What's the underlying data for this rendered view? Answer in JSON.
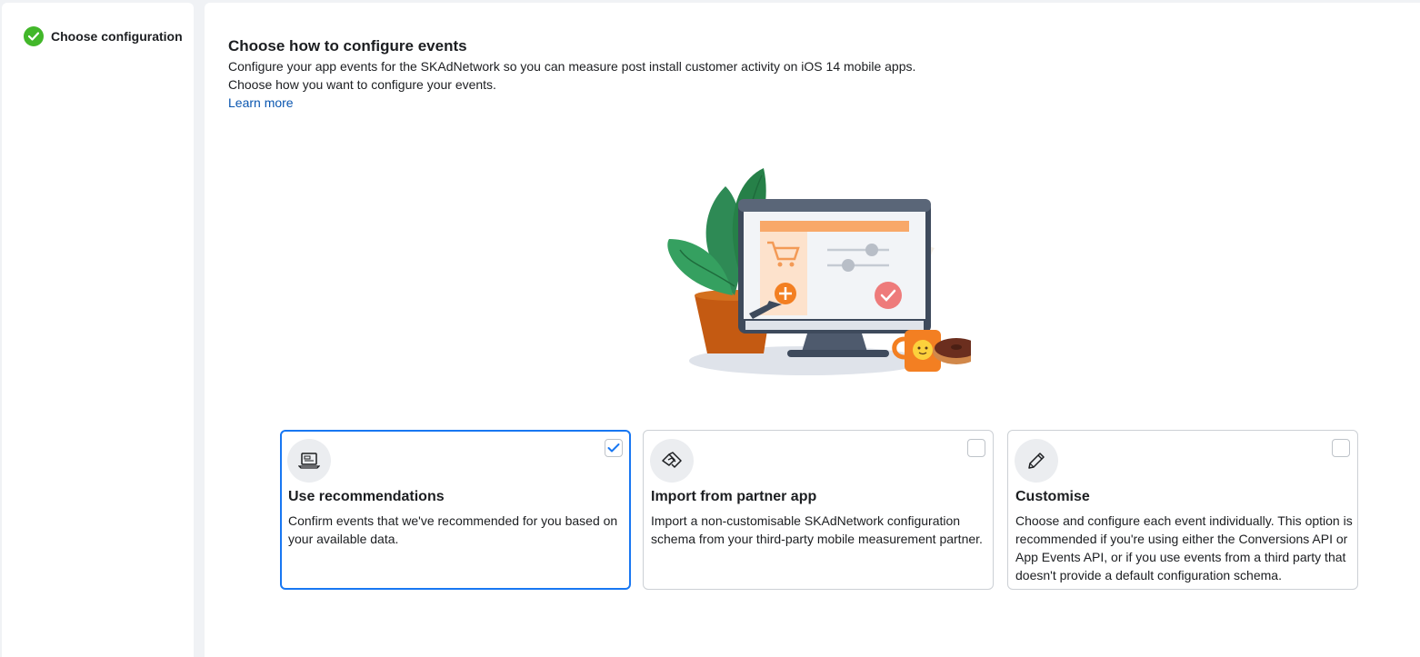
{
  "sidebar": {
    "steps": [
      {
        "label": "Choose configuration",
        "status": "complete",
        "icon": "check-circle-icon"
      }
    ]
  },
  "main": {
    "title": "Choose how to configure events",
    "description_line1": "Configure your app events for the SKAdNetwork so you can measure post install customer activity on iOS 14 mobile apps.",
    "description_line2": "Choose how you want to configure your events.",
    "learn_more": "Learn more"
  },
  "options": [
    {
      "title": "Use recommendations",
      "description": "Confirm events that we've recommended for you based on your available data.",
      "icon": "laptop-icon",
      "selected": true
    },
    {
      "title": "Import from partner app",
      "description": "Import a non-customisable SKAdNetwork configuration schema from your third-party mobile measurement partner.",
      "icon": "handshake-icon",
      "selected": false
    },
    {
      "title": "Customise",
      "description": "Choose and configure each event individually. This option is recommended if you're using either the Conversions API or App Events API, or if you use events from a third party that doesn't provide a default configuration schema.",
      "icon": "pencil-icon",
      "selected": false
    }
  ],
  "colors": {
    "accent": "#1877f2",
    "link": "#0a56b0",
    "success": "#42b72a",
    "border": "#ccd0d5"
  }
}
